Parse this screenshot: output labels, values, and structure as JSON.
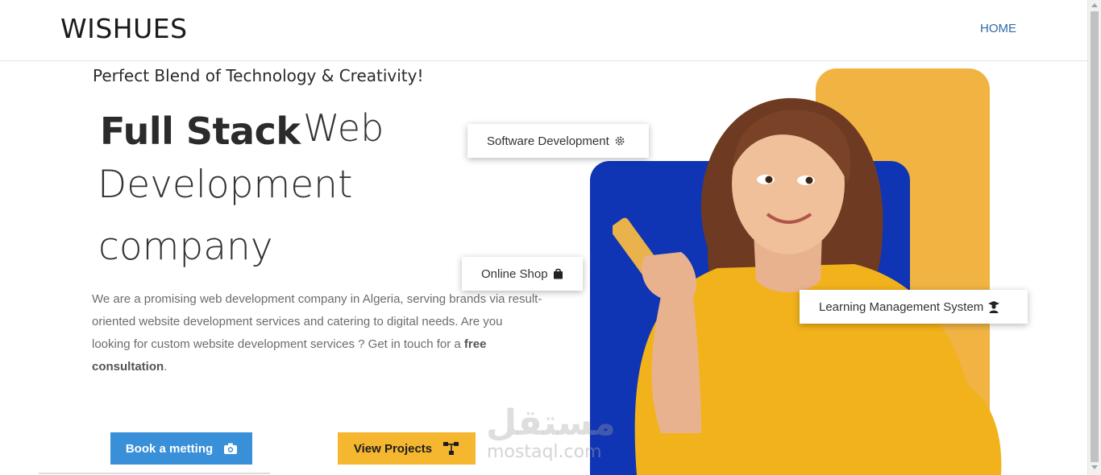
{
  "nav": {
    "brand": "WISHUES",
    "home_label": "HOME"
  },
  "hero": {
    "tagline": "Perfect Blend of Technology & Creativity!",
    "headline_bold": "Full Stack",
    "headline_web": "Web",
    "headline_line2": "Development",
    "headline_line3": "company",
    "description_main": "We are a promising web development company in Algeria, serving brands via result-oriented website development services and catering to digital needs.  Are you looking for custom website development services ? Get in touch for a ",
    "description_bold": "free consultation",
    "description_end": "."
  },
  "buttons": {
    "book_label": "Book a metting",
    "projects_label": "View Projects"
  },
  "chips": {
    "software": "Software Development",
    "shop": "Online Shop",
    "lms": "Learning Management System"
  },
  "watermark": {
    "arabic": "مستقل",
    "latin": "mostaql.com"
  },
  "colors": {
    "accent_blue": "#3a8fd9",
    "accent_orange": "#f5b630",
    "card_blue": "#0f35b4",
    "card_orange": "#f1b342",
    "nav_link": "#2f6aa8"
  },
  "icons": {
    "book": "camera-icon",
    "projects": "sitemap-icon",
    "software": "gear-icon",
    "shop": "shopping-bag-icon",
    "lms": "graduate-icon"
  }
}
